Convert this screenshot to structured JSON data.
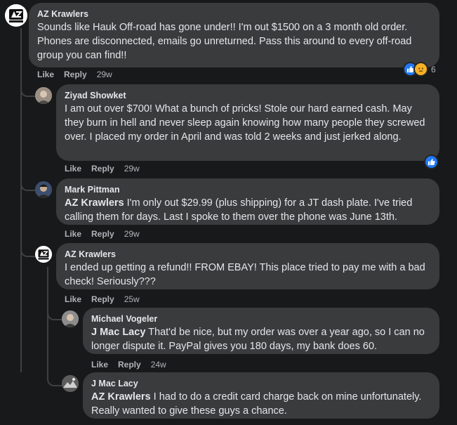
{
  "colors": {
    "background": "#18191a",
    "bubble": "#3a3b3c",
    "text": "#e4e6eb",
    "meta": "#b0b3b8",
    "like_blue": "#2078f4",
    "sad_yellow": "#f7b125",
    "thread_line": "#3e4042"
  },
  "actions": {
    "like": "Like",
    "reply": "Reply"
  },
  "comments": [
    {
      "author": "AZ Krawlers",
      "text": "Sounds like Hauk Off-road has gone under!! I'm out $1500 on a 3 month old order. Phones are disconnected, emails go unreturned. Pass this around to every off-road group you can find!!",
      "time": "29w",
      "reactions": [
        "like",
        "sad"
      ],
      "reaction_count": "6",
      "avatar": "az-krawlers-logo"
    },
    {
      "author": "Ziyad Showket",
      "text": "I am out over $700! What a bunch of pricks! Stole our hard earned cash. May they burn in hell and never sleep again knowing how many people they screwed over. I placed my order in April and was told 2 weeks and just jerked along.",
      "time": "29w",
      "reactions": [
        "like"
      ],
      "avatar": "profile-photo"
    },
    {
      "author": "Mark Pittman",
      "mention": "AZ Krawlers",
      "text": "I'm only out $29.99 (plus shipping) for a JT dash plate. I've tried calling them for days. Last I spoke to them over the phone was June 13th.",
      "time": "29w",
      "avatar": "profile-photo"
    },
    {
      "author": "AZ Krawlers",
      "text": "I ended up getting a refund!! FROM EBAY! This place tried to pay me with a bad check! Seriously???",
      "time": "25w",
      "avatar": "az-krawlers-logo"
    },
    {
      "author": "Michael Vogeler",
      "mention": "J Mac Lacy",
      "text": "That'd be nice, but my order was over a year ago, so I can no longer dispute it. PayPal gives you 180 days, my bank does 60.",
      "time": "24w",
      "avatar": "profile-photo"
    },
    {
      "author": "J Mac Lacy",
      "mention": "AZ Krawlers",
      "text": "I had to do a credit card charge back on mine unfortunately. Really wanted to give these guys a chance.",
      "avatar": "profile-photo"
    }
  ]
}
